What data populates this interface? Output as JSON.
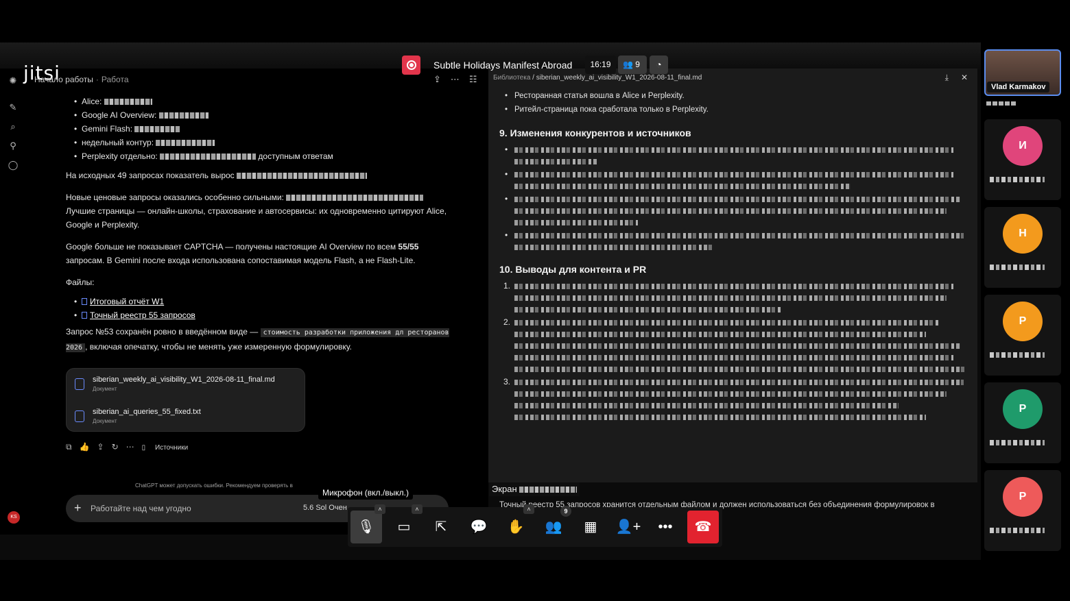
{
  "meeting": {
    "title": "Subtle Holidays Manifest Abroad",
    "timer": "16:19",
    "participants_count": "9",
    "logo_text": "jitsi",
    "tooltip": "Микрофон (вкл./выкл.)",
    "participants_badge": "9",
    "screen_label": "Экран",
    "hangup_color": "#e2232f",
    "record_color": "#e2354b"
  },
  "chatgpt": {
    "breadcrumb_project": "Начало работы",
    "breadcrumb_sub": "Работа",
    "bullets": [
      {
        "label": "Alice:"
      },
      {
        "label": "Google AI Overview:"
      },
      {
        "label": "Gemini Flash:"
      },
      {
        "label": "недельный контур:"
      },
      {
        "label": "Perplexity отдельно:",
        "tail": "доступным ответам"
      }
    ],
    "p1": "На исходных 49 запросах показатель вырос",
    "p2a": "Новые ценовые запросы оказались особенно сильными:",
    "p2b": "Лучшие страницы — онлайн-школы, страхование и автосервисы: их одновременно цитируют Alice, Google и Perplexity.",
    "p3a": "Google больше не показывает CAPTCHA — получены настоящие AI Overview по всем ",
    "p3b": "55/55",
    "p3c": " запросам. В Gemini после входа использована сопоставимая модель Flash, а не Flash-Lite.",
    "files_label": "Файлы:",
    "file_links": [
      "Итоговый отчёт W1",
      "Точный реестр 55 запросов"
    ],
    "p4a": "Запрос №53 сохранён ровно в введённом виде — ",
    "p4_code": "стоимость разработки приложения дл ресторанов 2026",
    "p4b": ", включая опечатку, чтобы не менять уже измеренную формулировку.",
    "attachments": [
      {
        "name": "siberian_weekly_ai_visibility_W1_2026-08-11_final.md",
        "type": "Документ"
      },
      {
        "name": "siberian_ai_queries_55_fixed.txt",
        "type": "Документ"
      }
    ],
    "sources_label": "Источники",
    "disclaimer": "ChatGPT может допускать ошибки. Рекомендуем проверять в",
    "composer_placeholder": "Работайте над чем угодно",
    "model_label": "5.6 Sol Очен",
    "avatar_initials": "KS"
  },
  "viewer": {
    "path_root": "Библиотека",
    "path_file": "siberian_weekly_ai_visibility_W1_2026-08-11_final.md",
    "top_bullets": [
      "Ресторанная статья вошла в Alice и Perplexity.",
      "Ритейл-страница пока сработала только в Perplexity."
    ],
    "h9": "9. Изменения конкурентов и источников",
    "h10": "10. Выводы для контента и PR",
    "numbers": [
      "1.",
      "2.",
      "3."
    ],
    "bottom_text": "Точный реестр 55 запросов хранится отдельным файлом и должен использоваться без объединения формулировок в"
  },
  "filmstrip": {
    "me_name": "Vlad Karmakov",
    "avatars": [
      {
        "color": "#e0457b",
        "initials": "И"
      },
      {
        "color": "#f39a1d",
        "initials": "Н"
      },
      {
        "color": "#f39a1d",
        "initials": "Р"
      },
      {
        "color": "#1f9b6b",
        "initials": "Р"
      },
      {
        "color": "#ee5a5a",
        "initials": "Р"
      }
    ]
  }
}
